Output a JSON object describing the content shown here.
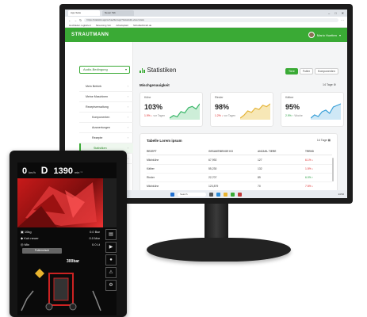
{
  "browser": {
    "tabs": [
      "App-Seite",
      "Neuer Tab"
    ],
    "address": "https://statistik.app/schaeffer/app?&statistik-view=stats",
    "bookmarks": [
      "Hochladen registriert",
      "Streaming Vid.",
      "Arbeitsplatz",
      "Schulfachkraft.de"
    ]
  },
  "header": {
    "logo": "STRAUTMANN",
    "user_name": "Mario Huetten"
  },
  "sidebar": {
    "select_value": "Audio-Bedingung",
    "items": [
      {
        "label": "Mein Betrieb",
        "sub": false,
        "active": false
      },
      {
        "label": "Meine Maschinen",
        "sub": false,
        "active": false
      },
      {
        "label": "Rezeptverwaltung",
        "sub": false,
        "active": false
      },
      {
        "label": "Komponenten",
        "sub": true,
        "active": false
      },
      {
        "label": "Auswertungen",
        "sub": true,
        "active": false
      },
      {
        "label": "Rezepte",
        "sub": true,
        "active": false
      },
      {
        "label": "Statistiken",
        "sub": true,
        "active": true
      },
      {
        "label": "Training",
        "sub": false,
        "active": false
      }
    ]
  },
  "main": {
    "title": "Statistiken",
    "period": [
      "Tiere",
      "Futter",
      "Komponenten"
    ],
    "section_title": "Mischgenauigkeit",
    "section_range": "14 Tage",
    "cards": [
      {
        "name": "Kühe",
        "percent": "103%",
        "delta": "1.9% ↓",
        "delta_note": "vor Tagen",
        "trend": "down",
        "color": "#3bb76a",
        "fill": "#cdeed8",
        "spark": [
          4,
          6,
          5,
          9,
          8,
          12,
          13,
          11,
          15
        ]
      },
      {
        "name": "Rinder",
        "percent": "98%",
        "delta": "1.2% ↓",
        "delta_note": "vor Tagen",
        "trend": "down",
        "color": "#e5b53a",
        "fill": "#f7e7b6",
        "spark": [
          3,
          5,
          8,
          7,
          10,
          9,
          12,
          11,
          13
        ]
      },
      {
        "name": "Kälber",
        "percent": "95%",
        "delta": "2.9% ↑",
        "delta_note": "Woche",
        "trend": "up",
        "color": "#3aa0d8",
        "fill": "#cfe8f6",
        "spark": [
          5,
          7,
          6,
          9,
          10,
          8,
          12,
          13,
          14
        ]
      }
    ],
    "table": {
      "title": "Tabelle Lorem ipsum",
      "range": "14 Tage",
      "headers": [
        "REZEPT",
        "GESAMTMENGE KG",
        "ANZAHL TIERE",
        "TREND"
      ],
      "rows": [
        {
          "rezept": "Milchkühe",
          "menge": "67,992",
          "tiere": "127",
          "trend": "6.1% ↓",
          "dir": "down"
        },
        {
          "rezept": "Kälber",
          "menge": "55,230",
          "tiere": "132",
          "trend": "1.5% ↓",
          "dir": "down"
        },
        {
          "rezept": "Rinder",
          "menge": "22,707",
          "tiere": "89",
          "trend": "6.0% ↑",
          "dir": "up"
        },
        {
          "rezept": "Milchkühe",
          "menge": "123,879",
          "tiere": "70",
          "trend": "7.5% ↓",
          "dir": "down"
        }
      ]
    }
  },
  "taskbar": {
    "search": "Search",
    "tray_time": "14:52"
  },
  "terminal": {
    "speed": "0",
    "speed_unit": "km/h",
    "gear": "D",
    "rpm": "1390",
    "rpm_unit": "min⁻¹",
    "rows": [
      "10kg",
      "Kuh neuer",
      "Mix"
    ],
    "rows_right": [
      "0.0 Bar",
      "0.0 Mor",
      "0.0 Lt"
    ],
    "field_label": "Futtermisch",
    "bar_readout": "300bar"
  }
}
